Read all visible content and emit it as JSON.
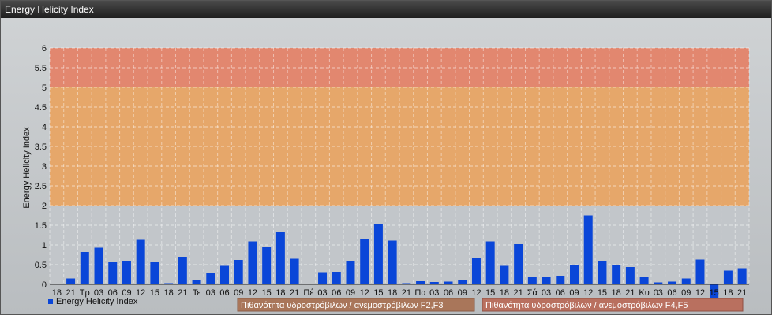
{
  "window": {
    "title": "Energy Helicity Index"
  },
  "colors": {
    "bar": "#0a46d8",
    "zone_low": "#c2c6ca",
    "zone_mid": "#e6a76a",
    "zone_high": "#e2876f",
    "zone_f23": "#a9765a",
    "zone_f45": "#b9705f"
  },
  "legend": {
    "series_label": "Energy Helicity Index",
    "zone_f23": "Πιθανότητα υδροστρόβιλων / ανεμοστρόβιλων F2,F3",
    "zone_f45": "Πιθανότητα υδροστρόβιλων / ανεμοστρόβιλων F4,F5"
  },
  "chart_data": {
    "type": "bar",
    "ylabel": "Energy Helicity Index",
    "ylim": [
      0,
      6
    ],
    "yticks": [
      "0",
      "0.5",
      "1",
      "1.5",
      "2",
      "2.5",
      "3",
      "3.5",
      "4",
      "4.5",
      "5",
      "5.5",
      "6"
    ],
    "grid": true,
    "legend_position": "bottom-left",
    "bands": [
      {
        "from": 0,
        "to": 2,
        "color": "#c2c6ca"
      },
      {
        "from": 2,
        "to": 5,
        "color": "#e6a76a"
      },
      {
        "from": 5,
        "to": 6,
        "color": "#e2876f"
      }
    ],
    "categories": [
      "18",
      "21",
      "Τρ",
      "03",
      "06",
      "09",
      "12",
      "15",
      "18",
      "21",
      "Τε",
      "03",
      "06",
      "09",
      "12",
      "15",
      "18",
      "21",
      "Πέ",
      "03",
      "06",
      "09",
      "12",
      "15",
      "18",
      "21",
      "Πα",
      "03",
      "06",
      "09",
      "12",
      "15",
      "18",
      "21",
      "Σά",
      "03",
      "06",
      "09",
      "12",
      "15",
      "18",
      "21",
      "Κυ",
      "03",
      "06",
      "09",
      "12",
      "15",
      "18",
      "21"
    ],
    "series": [
      {
        "name": "Energy Helicity Index",
        "values": [
          0.02,
          0.15,
          0.82,
          0.93,
          0.56,
          0.6,
          1.13,
          0.56,
          0.03,
          0.7,
          0.1,
          0.28,
          0.47,
          0.62,
          1.09,
          0.94,
          1.33,
          0.65,
          0.02,
          0.29,
          0.32,
          0.58,
          1.15,
          1.54,
          1.11,
          0.03,
          0.08,
          0.06,
          0.07,
          0.1,
          0.67,
          1.09,
          0.47,
          1.02,
          0.18,
          0.18,
          0.2,
          0.5,
          1.75,
          0.58,
          0.48,
          0.44,
          0.18,
          0.05,
          0.07,
          0.15,
          0.63,
          -0.4,
          0.35,
          0.41
        ]
      }
    ]
  }
}
